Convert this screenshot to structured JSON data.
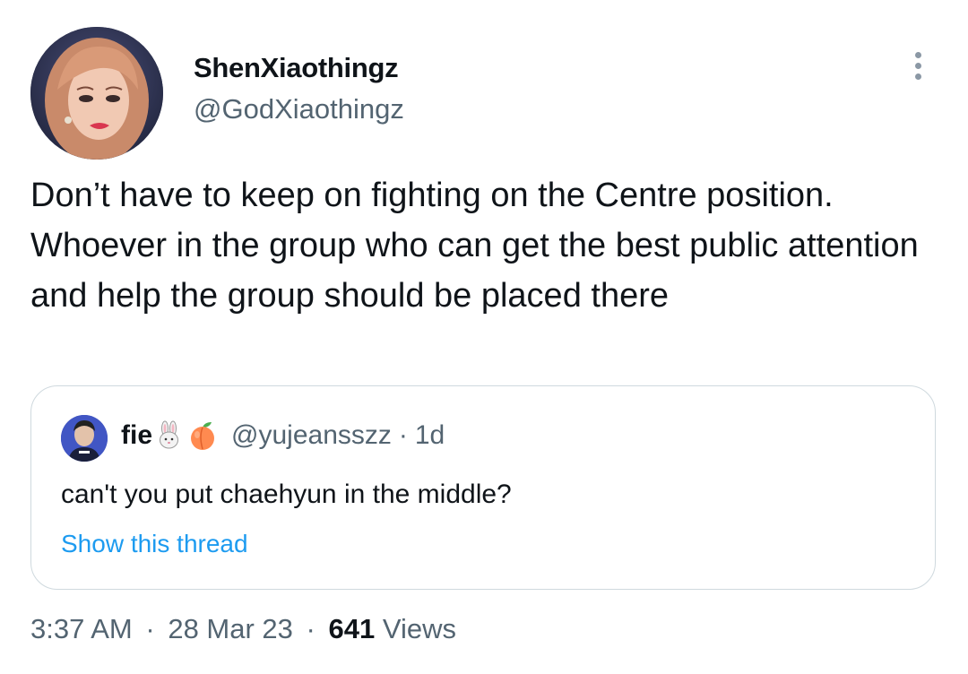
{
  "author": {
    "display_name": "ShenXiaothingz",
    "handle": "@GodXiaothingz"
  },
  "tweet": {
    "text": "Don’t have to keep on fighting on the Centre position. Whoever in the group who can get the best public attention and help the group should be placed there"
  },
  "quoted_tweet": {
    "name": "fie",
    "emojis": [
      "rabbit-emoji-icon",
      "peach-emoji-icon"
    ],
    "handle": "@yujeansszz",
    "separator": "·",
    "time": "1d",
    "text": "can't you put chaehyun in the middle?",
    "link_label": "Show this thread"
  },
  "meta": {
    "time": "3:37 AM",
    "separator": "·",
    "date": "28 Mar 23",
    "views_count": "641",
    "views_label": "Views"
  },
  "icons": {
    "more": "more-options-icon"
  },
  "colors": {
    "primary_text": "#0f1419",
    "secondary_text": "#536471",
    "link": "#1d9bf0",
    "border": "#cfd9de"
  }
}
